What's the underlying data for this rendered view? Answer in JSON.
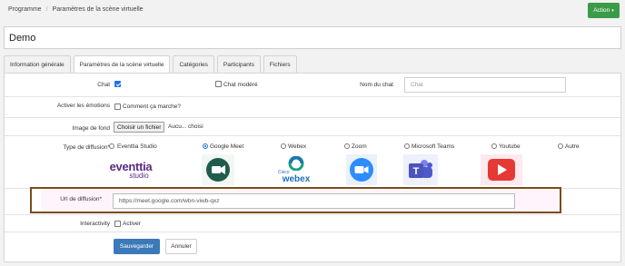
{
  "breadcrumb": {
    "root": "Programme",
    "current": "Paramètres de la scène virtuelle"
  },
  "header": {
    "action_label": "Action",
    "caret": "▾"
  },
  "title": "Demo",
  "tabs": [
    {
      "label": "Information générale",
      "active": false
    },
    {
      "label": "Paramètres de la scène virtuelle",
      "active": true
    },
    {
      "label": "Catégories",
      "active": false
    },
    {
      "label": "Participants",
      "active": false
    },
    {
      "label": "Fichiers",
      "active": false
    }
  ],
  "form": {
    "chat_label": "Chat",
    "chat_checked": true,
    "chat_modere_label": "Chat modéré",
    "chat_modere_checked": false,
    "nom_du_chat_label": "Nom du chat",
    "nom_du_chat_placeholder": "Chat",
    "emotions_label": "Activer les émotions",
    "emotions_option": "Comment ça marche?",
    "image_label": "Image de fond",
    "file_button": "Choisir un fichier",
    "file_status": "Aucu... choisi",
    "diffusion_label": "Type de diffusion*",
    "diffusion_options": [
      {
        "label": "Eventtia Studio",
        "selected": false,
        "icon": "eventtia-studio-logo"
      },
      {
        "label": "Google Meet",
        "selected": true,
        "icon": "google-meet-logo"
      },
      {
        "label": "Webex",
        "selected": false,
        "icon": "cisco-webex-logo"
      },
      {
        "label": "Zoom",
        "selected": false,
        "icon": "zoom-logo"
      },
      {
        "label": "Microsoft Teams",
        "selected": false,
        "icon": "microsoft-teams-logo"
      },
      {
        "label": "Youtube",
        "selected": false,
        "icon": "youtube-logo"
      },
      {
        "label": "Autre",
        "selected": false,
        "icon": ""
      }
    ],
    "logo_text": {
      "eventtia": "eventtia",
      "studio": "studio",
      "cisco": "Cisco",
      "webex": "webex"
    },
    "url_label": "Url de diffusion*",
    "url_value": "https://meet.google.com/wbn-viwb-qxz",
    "interactivity_label": "Interactivity",
    "interactivity_option": "Activer",
    "save_label": "Sauvegarder",
    "cancel_label": "Annuler"
  },
  "colors": {
    "action_green": "#3c9b48",
    "primary_blue": "#3b7ab8",
    "highlight_border": "#7a4c1a",
    "eventtia_purple": "#5b2a86",
    "youtube_red": "#e53935"
  }
}
